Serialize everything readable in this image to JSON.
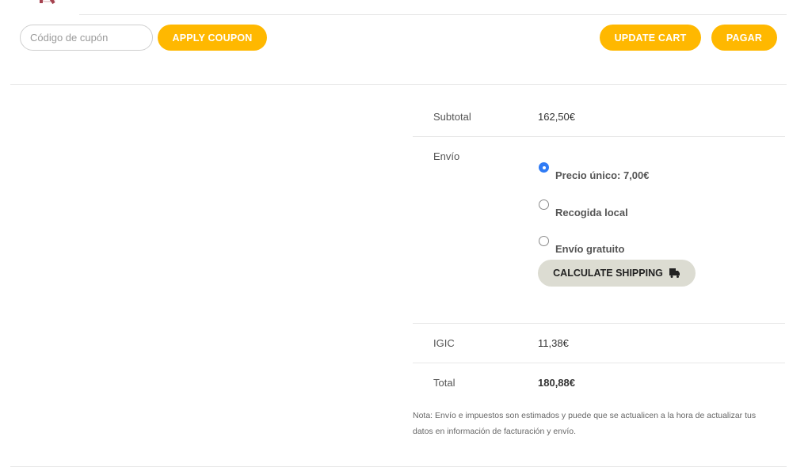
{
  "coupon": {
    "placeholder": "Código de cupón",
    "apply_label": "APPLY COUPON"
  },
  "cart_actions": {
    "update_label": "UPDATE CART",
    "pay_label": "PAGAR"
  },
  "totals": {
    "subtotal_label": "Subtotal",
    "subtotal_value": "162,50€",
    "shipping_label": "Envío",
    "shipping_options": [
      {
        "label": "Precio único: 7,00€",
        "selected": true
      },
      {
        "label": "Recogida local",
        "selected": false
      },
      {
        "label": "Envío gratuito",
        "selected": false
      }
    ],
    "calculate_shipping_label": "CALCULATE SHIPPING",
    "tax_label": "IGIC",
    "tax_value": "11,38€",
    "total_label": "Total",
    "total_value": "180,88€",
    "note": "Nota: Envío e impuestos son estimados y puede que se actualicen a la hora de actualizar tus datos en información de facturación y envío."
  },
  "colors": {
    "accent": "#ffb800",
    "radio_selected": "#2f7bf5",
    "secondary_button": "#dcdcd2",
    "logo": "#a5424f"
  },
  "icons": {
    "shipping_button": "truck-icon"
  }
}
